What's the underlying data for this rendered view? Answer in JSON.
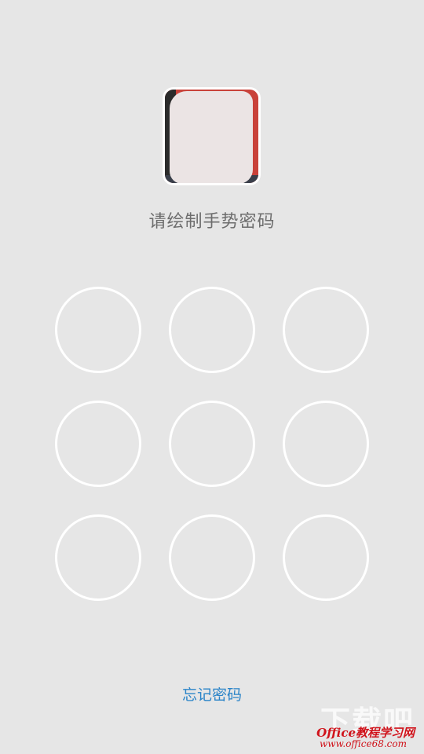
{
  "lock_screen": {
    "prompt": "请绘制手势密码",
    "forgot_password": "忘记密码",
    "pattern_dots": [
      1,
      2,
      3,
      4,
      5,
      6,
      7,
      8,
      9
    ]
  },
  "watermark": {
    "big_text": "下载吧",
    "site_name": "Office教程学习网",
    "url": "www.office68.com"
  },
  "colors": {
    "background": "#e6e6e6",
    "dot_ring": "#ffffff",
    "link": "#2a84c8",
    "watermark": "#d0131b"
  }
}
